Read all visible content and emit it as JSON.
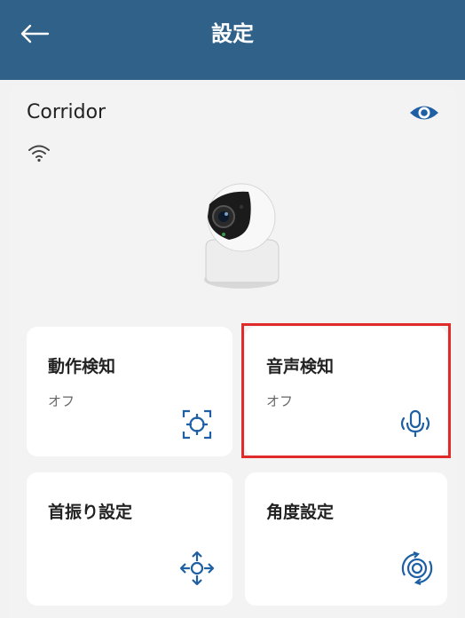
{
  "header": {
    "title": "設定",
    "back_icon": "arrow-left-icon"
  },
  "device": {
    "name": "Corridor",
    "visibility_icon": "eye-icon",
    "signal_icon": "wifi-icon"
  },
  "cards": [
    {
      "id": "motion",
      "title": "動作検知",
      "status": "オフ",
      "icon": "crosshair-icon"
    },
    {
      "id": "sound",
      "title": "音声検知",
      "status": "オフ",
      "icon": "microphone-icon"
    },
    {
      "id": "pan",
      "title": "首振り設定",
      "status": "",
      "icon": "pan-arrows-icon"
    },
    {
      "id": "angle",
      "title": "角度設定",
      "status": "",
      "icon": "rotate-icon"
    }
  ],
  "colors": {
    "header_bg": "#2f6189",
    "accent": "#1f5fa3",
    "highlight": "#e12a2a"
  }
}
